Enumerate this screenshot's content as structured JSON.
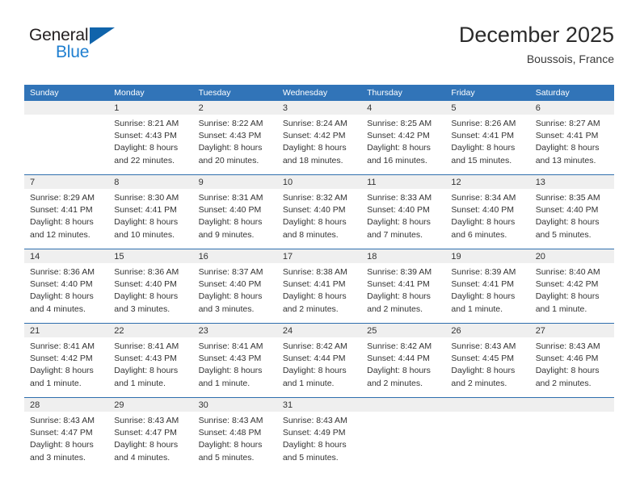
{
  "brand": {
    "name_part1": "General",
    "name_part2": "Blue",
    "flag_icon": "flag-icon",
    "accent_color": "#1064ab",
    "blue_text_color": "#1f7fd0"
  },
  "header": {
    "title": "December 2025",
    "subtitle": "Boussois, France"
  },
  "calendar": {
    "header_bg": "#3174b8",
    "band_bg": "#efefef",
    "separator_color": "#2f6fae",
    "weekdays": [
      "Sunday",
      "Monday",
      "Tuesday",
      "Wednesday",
      "Thursday",
      "Friday",
      "Saturday"
    ],
    "weeks": [
      [
        {
          "day": "",
          "sunrise": "",
          "sunset": "",
          "daylight_1": "",
          "daylight_2": ""
        },
        {
          "day": "1",
          "sunrise": "Sunrise: 8:21 AM",
          "sunset": "Sunset: 4:43 PM",
          "daylight_1": "Daylight: 8 hours",
          "daylight_2": "and 22 minutes."
        },
        {
          "day": "2",
          "sunrise": "Sunrise: 8:22 AM",
          "sunset": "Sunset: 4:43 PM",
          "daylight_1": "Daylight: 8 hours",
          "daylight_2": "and 20 minutes."
        },
        {
          "day": "3",
          "sunrise": "Sunrise: 8:24 AM",
          "sunset": "Sunset: 4:42 PM",
          "daylight_1": "Daylight: 8 hours",
          "daylight_2": "and 18 minutes."
        },
        {
          "day": "4",
          "sunrise": "Sunrise: 8:25 AM",
          "sunset": "Sunset: 4:42 PM",
          "daylight_1": "Daylight: 8 hours",
          "daylight_2": "and 16 minutes."
        },
        {
          "day": "5",
          "sunrise": "Sunrise: 8:26 AM",
          "sunset": "Sunset: 4:41 PM",
          "daylight_1": "Daylight: 8 hours",
          "daylight_2": "and 15 minutes."
        },
        {
          "day": "6",
          "sunrise": "Sunrise: 8:27 AM",
          "sunset": "Sunset: 4:41 PM",
          "daylight_1": "Daylight: 8 hours",
          "daylight_2": "and 13 minutes."
        }
      ],
      [
        {
          "day": "7",
          "sunrise": "Sunrise: 8:29 AM",
          "sunset": "Sunset: 4:41 PM",
          "daylight_1": "Daylight: 8 hours",
          "daylight_2": "and 12 minutes."
        },
        {
          "day": "8",
          "sunrise": "Sunrise: 8:30 AM",
          "sunset": "Sunset: 4:41 PM",
          "daylight_1": "Daylight: 8 hours",
          "daylight_2": "and 10 minutes."
        },
        {
          "day": "9",
          "sunrise": "Sunrise: 8:31 AM",
          "sunset": "Sunset: 4:40 PM",
          "daylight_1": "Daylight: 8 hours",
          "daylight_2": "and 9 minutes."
        },
        {
          "day": "10",
          "sunrise": "Sunrise: 8:32 AM",
          "sunset": "Sunset: 4:40 PM",
          "daylight_1": "Daylight: 8 hours",
          "daylight_2": "and 8 minutes."
        },
        {
          "day": "11",
          "sunrise": "Sunrise: 8:33 AM",
          "sunset": "Sunset: 4:40 PM",
          "daylight_1": "Daylight: 8 hours",
          "daylight_2": "and 7 minutes."
        },
        {
          "day": "12",
          "sunrise": "Sunrise: 8:34 AM",
          "sunset": "Sunset: 4:40 PM",
          "daylight_1": "Daylight: 8 hours",
          "daylight_2": "and 6 minutes."
        },
        {
          "day": "13",
          "sunrise": "Sunrise: 8:35 AM",
          "sunset": "Sunset: 4:40 PM",
          "daylight_1": "Daylight: 8 hours",
          "daylight_2": "and 5 minutes."
        }
      ],
      [
        {
          "day": "14",
          "sunrise": "Sunrise: 8:36 AM",
          "sunset": "Sunset: 4:40 PM",
          "daylight_1": "Daylight: 8 hours",
          "daylight_2": "and 4 minutes."
        },
        {
          "day": "15",
          "sunrise": "Sunrise: 8:36 AM",
          "sunset": "Sunset: 4:40 PM",
          "daylight_1": "Daylight: 8 hours",
          "daylight_2": "and 3 minutes."
        },
        {
          "day": "16",
          "sunrise": "Sunrise: 8:37 AM",
          "sunset": "Sunset: 4:40 PM",
          "daylight_1": "Daylight: 8 hours",
          "daylight_2": "and 3 minutes."
        },
        {
          "day": "17",
          "sunrise": "Sunrise: 8:38 AM",
          "sunset": "Sunset: 4:41 PM",
          "daylight_1": "Daylight: 8 hours",
          "daylight_2": "and 2 minutes."
        },
        {
          "day": "18",
          "sunrise": "Sunrise: 8:39 AM",
          "sunset": "Sunset: 4:41 PM",
          "daylight_1": "Daylight: 8 hours",
          "daylight_2": "and 2 minutes."
        },
        {
          "day": "19",
          "sunrise": "Sunrise: 8:39 AM",
          "sunset": "Sunset: 4:41 PM",
          "daylight_1": "Daylight: 8 hours",
          "daylight_2": "and 1 minute."
        },
        {
          "day": "20",
          "sunrise": "Sunrise: 8:40 AM",
          "sunset": "Sunset: 4:42 PM",
          "daylight_1": "Daylight: 8 hours",
          "daylight_2": "and 1 minute."
        }
      ],
      [
        {
          "day": "21",
          "sunrise": "Sunrise: 8:41 AM",
          "sunset": "Sunset: 4:42 PM",
          "daylight_1": "Daylight: 8 hours",
          "daylight_2": "and 1 minute."
        },
        {
          "day": "22",
          "sunrise": "Sunrise: 8:41 AM",
          "sunset": "Sunset: 4:43 PM",
          "daylight_1": "Daylight: 8 hours",
          "daylight_2": "and 1 minute."
        },
        {
          "day": "23",
          "sunrise": "Sunrise: 8:41 AM",
          "sunset": "Sunset: 4:43 PM",
          "daylight_1": "Daylight: 8 hours",
          "daylight_2": "and 1 minute."
        },
        {
          "day": "24",
          "sunrise": "Sunrise: 8:42 AM",
          "sunset": "Sunset: 4:44 PM",
          "daylight_1": "Daylight: 8 hours",
          "daylight_2": "and 1 minute."
        },
        {
          "day": "25",
          "sunrise": "Sunrise: 8:42 AM",
          "sunset": "Sunset: 4:44 PM",
          "daylight_1": "Daylight: 8 hours",
          "daylight_2": "and 2 minutes."
        },
        {
          "day": "26",
          "sunrise": "Sunrise: 8:43 AM",
          "sunset": "Sunset: 4:45 PM",
          "daylight_1": "Daylight: 8 hours",
          "daylight_2": "and 2 minutes."
        },
        {
          "day": "27",
          "sunrise": "Sunrise: 8:43 AM",
          "sunset": "Sunset: 4:46 PM",
          "daylight_1": "Daylight: 8 hours",
          "daylight_2": "and 2 minutes."
        }
      ],
      [
        {
          "day": "28",
          "sunrise": "Sunrise: 8:43 AM",
          "sunset": "Sunset: 4:47 PM",
          "daylight_1": "Daylight: 8 hours",
          "daylight_2": "and 3 minutes."
        },
        {
          "day": "29",
          "sunrise": "Sunrise: 8:43 AM",
          "sunset": "Sunset: 4:47 PM",
          "daylight_1": "Daylight: 8 hours",
          "daylight_2": "and 4 minutes."
        },
        {
          "day": "30",
          "sunrise": "Sunrise: 8:43 AM",
          "sunset": "Sunset: 4:48 PM",
          "daylight_1": "Daylight: 8 hours",
          "daylight_2": "and 5 minutes."
        },
        {
          "day": "31",
          "sunrise": "Sunrise: 8:43 AM",
          "sunset": "Sunset: 4:49 PM",
          "daylight_1": "Daylight: 8 hours",
          "daylight_2": "and 5 minutes."
        },
        {
          "day": "",
          "sunrise": "",
          "sunset": "",
          "daylight_1": "",
          "daylight_2": ""
        },
        {
          "day": "",
          "sunrise": "",
          "sunset": "",
          "daylight_1": "",
          "daylight_2": ""
        },
        {
          "day": "",
          "sunrise": "",
          "sunset": "",
          "daylight_1": "",
          "daylight_2": ""
        }
      ]
    ]
  }
}
